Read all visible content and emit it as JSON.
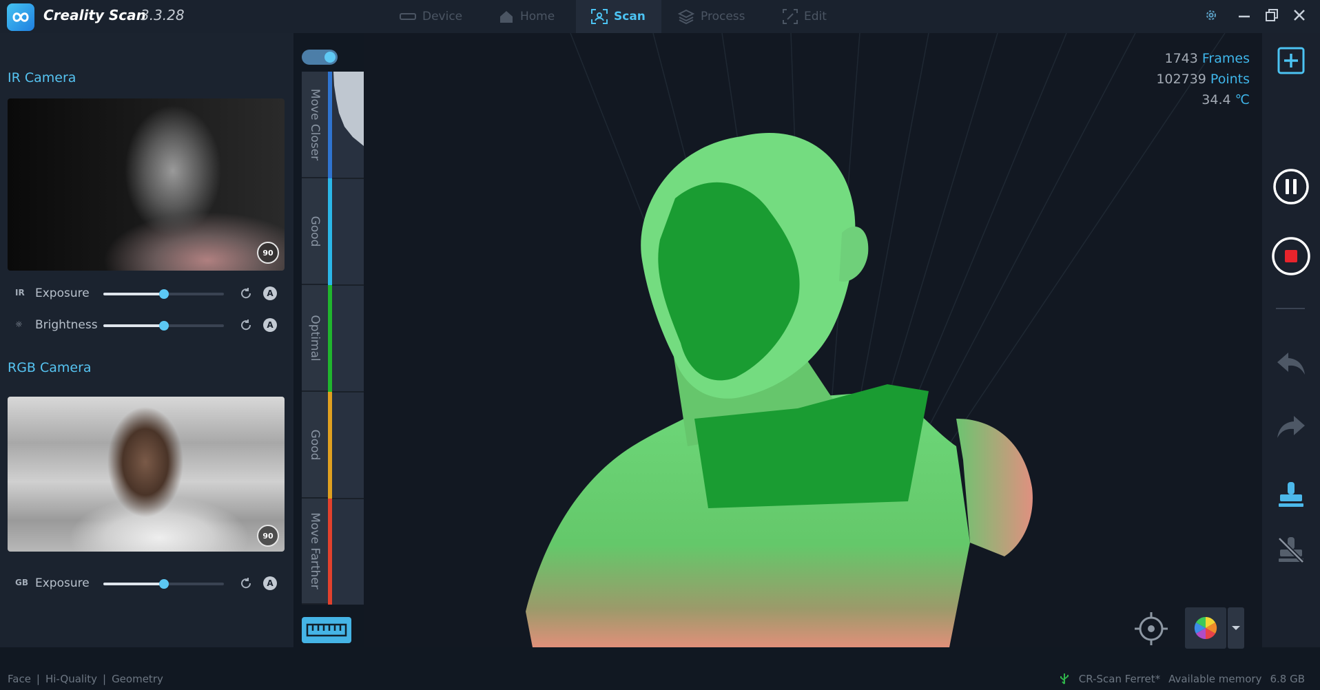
{
  "app": {
    "name": "Creality Scan",
    "version": "3.3.28"
  },
  "nav": {
    "tabs": [
      {
        "label": "Device",
        "icon": "device-icon",
        "active": false
      },
      {
        "label": "Home",
        "icon": "home-icon",
        "active": false
      },
      {
        "label": "Scan",
        "icon": "scan-icon",
        "active": true
      },
      {
        "label": "Process",
        "icon": "process-icon",
        "active": false
      },
      {
        "label": "Edit",
        "icon": "edit-icon",
        "active": false
      }
    ]
  },
  "ir_camera": {
    "title": "IR Camera",
    "rotate_label": "90",
    "controls": [
      {
        "icon_text": "IR",
        "label": "Exposure",
        "value": 0.5
      },
      {
        "icon_text": "☼",
        "label": "Brightness",
        "value": 0.5
      }
    ]
  },
  "rgb_camera": {
    "title": "RGB Camera",
    "rotate_label": "90",
    "controls": [
      {
        "icon_text": "GB",
        "label": "Exposure",
        "value": 0.5
      }
    ]
  },
  "distance": {
    "toggle_on": true,
    "segments": [
      {
        "label": "Move Closer",
        "color": "#2f74d0"
      },
      {
        "label": "Good",
        "color": "#2bb7e8"
      },
      {
        "label": "Optimal",
        "color": "#20b52e"
      },
      {
        "label": "Good",
        "color": "#e0a020"
      },
      {
        "label": "Move Farther",
        "color": "#e2412d"
      }
    ]
  },
  "stats": {
    "frames_value": "1743",
    "frames_label": "Frames",
    "points_value": "102739",
    "points_label": "Points",
    "temp_value": "34.4",
    "temp_unit": "℃"
  },
  "status": {
    "mode": "Face",
    "quality": "Hi-Quality",
    "texture": "Geometry",
    "device": "CR-Scan Ferret*",
    "memory_label": "Available memory",
    "memory_value": "6.8 GB"
  },
  "colors": {
    "accent": "#4cc3f2",
    "stop": "#e8242c"
  }
}
